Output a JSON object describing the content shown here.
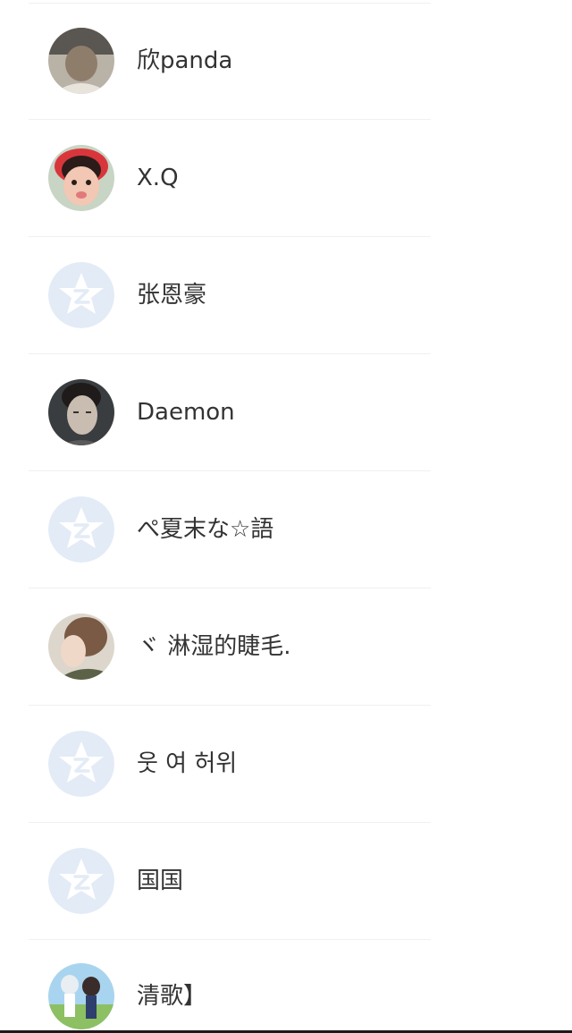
{
  "contacts": [
    {
      "name": "欣panda",
      "avatar": "photo-avatar"
    },
    {
      "name": "X.Q",
      "avatar": "photo-avatar"
    },
    {
      "name": "张恩豪",
      "avatar": "default-star-avatar"
    },
    {
      "name": "Daemon",
      "avatar": "photo-avatar"
    },
    {
      "name": "ぺ夏末な☆語",
      "avatar": "default-star-avatar"
    },
    {
      "name": "ヾ 淋湿的睫毛.",
      "avatar": "photo-avatar"
    },
    {
      "name": "웃 여 허위",
      "avatar": "default-star-avatar"
    },
    {
      "name": "国国",
      "avatar": "default-star-avatar"
    },
    {
      "name": "清歌】",
      "avatar": "photo-avatar"
    }
  ],
  "colors": {
    "default_avatar_bg": "#e3ebf6",
    "default_avatar_star": "#ffffff",
    "separator": "#f0f0f0",
    "text": "#333333"
  }
}
